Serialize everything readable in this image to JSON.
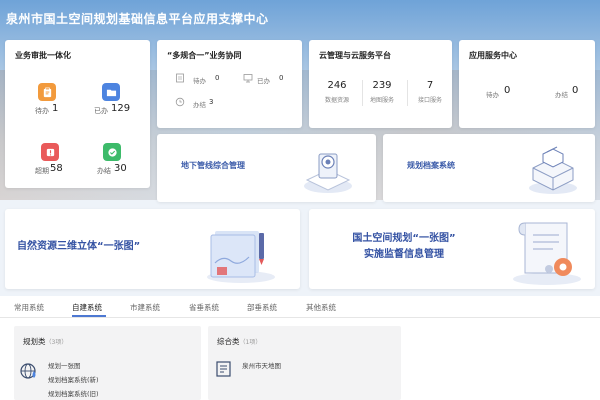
{
  "app_title": "泉州市国土空间规划基础信息平台应用支撑中心",
  "approval": {
    "title": "业务审批一体化",
    "tiles": [
      {
        "label": "待办",
        "value": "1",
        "color": "#f29a3c",
        "icon": "clipboard-icon"
      },
      {
        "label": "已办",
        "value": "129",
        "color": "#4d84e0",
        "icon": "folder-icon"
      },
      {
        "label": "超期",
        "value": "58",
        "color": "#e95a5a",
        "icon": "alarm-icon"
      },
      {
        "label": "办结",
        "value": "30",
        "color": "#3dbb6a",
        "icon": "check-icon"
      }
    ]
  },
  "collab": {
    "title": "“多规合一”业务协同",
    "items": [
      {
        "label": "待办",
        "value": "0",
        "icon": "file-icon"
      },
      {
        "label": "已办",
        "value": "0",
        "icon": "monitor-icon"
      },
      {
        "label": "办结",
        "value": "3",
        "icon": "clock-icon"
      }
    ]
  },
  "cloud": {
    "title": "云管理与云服务平台",
    "stats": [
      {
        "value": "246",
        "label": "数据资源"
      },
      {
        "value": "239",
        "label": "地图服务"
      },
      {
        "value": "7",
        "label": "接口服务"
      }
    ]
  },
  "app_center": {
    "title": "应用服务中心",
    "items": [
      {
        "label": "待办",
        "value": "0"
      },
      {
        "label": "办结",
        "value": "0"
      }
    ]
  },
  "pipeline": {
    "label": "地下管线综合管理"
  },
  "archive": {
    "label": "规划档案系统"
  },
  "natural": {
    "label": "自然资源三维立体“一张图”"
  },
  "supervision": {
    "line1": "国土空间规划“一张图”",
    "line2": "实施监督信息管理"
  },
  "tabs": [
    "常用系统",
    "自建系统",
    "市建系统",
    "省垂系统",
    "部垂系统",
    "其他系统"
  ],
  "active_tab": "自建系统",
  "groups": [
    {
      "title": "规划类",
      "count": "（3项）",
      "items": [
        "规划一张图",
        "规划档案系统(新)",
        "规划档案系统(旧)"
      ]
    },
    {
      "title": "综合类",
      "count": "（1项）",
      "items": [
        "泉州市天地图"
      ]
    }
  ],
  "colors": {
    "accent": "#4d78d2",
    "title_blue": "#3452a3"
  }
}
